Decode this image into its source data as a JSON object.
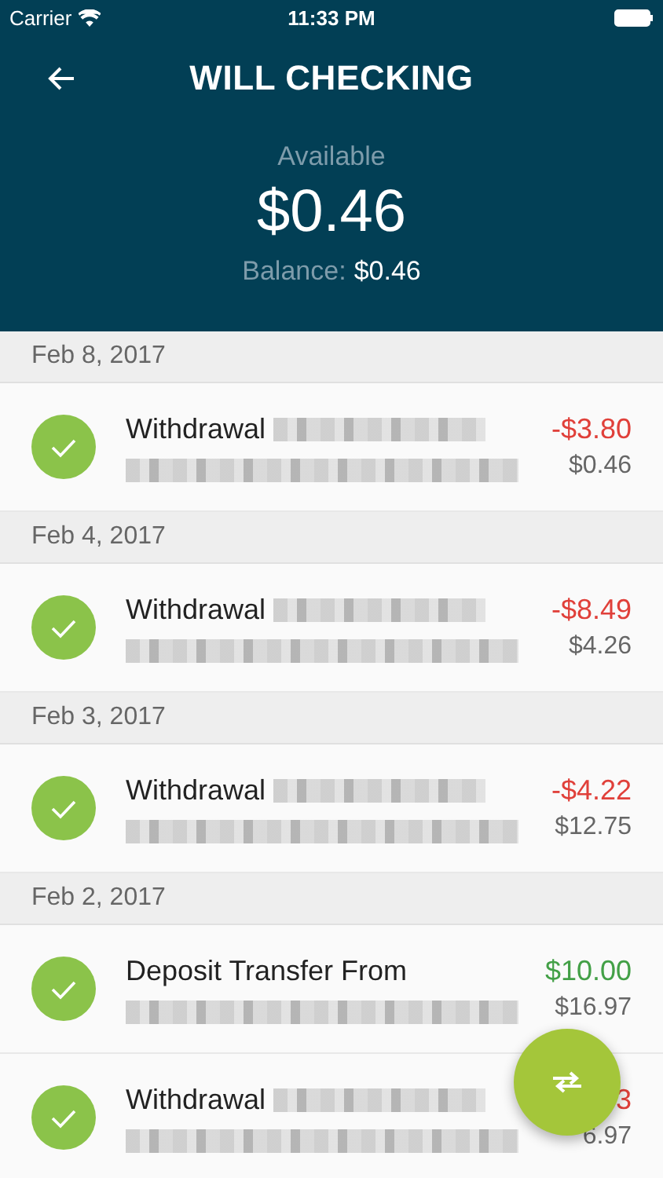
{
  "status_bar": {
    "carrier": "Carrier",
    "time": "11:33 PM"
  },
  "header": {
    "title": "WILL CHECKING",
    "available_label": "Available",
    "available_amount": "$0.46",
    "balance_label": "Balance:",
    "balance_amount": "$0.46"
  },
  "groups": [
    {
      "date": "Feb 8, 2017",
      "transactions": [
        {
          "kind": "withdrawal",
          "title": "Withdrawal",
          "amount": "-$3.80",
          "balance": "$0.46",
          "cleared": true
        }
      ]
    },
    {
      "date": "Feb 4, 2017",
      "transactions": [
        {
          "kind": "withdrawal",
          "title": "Withdrawal",
          "amount": "-$8.49",
          "balance": "$4.26",
          "cleared": true
        }
      ]
    },
    {
      "date": "Feb 3, 2017",
      "transactions": [
        {
          "kind": "withdrawal",
          "title": "Withdrawal",
          "amount": "-$4.22",
          "balance": "$12.75",
          "cleared": true
        }
      ]
    },
    {
      "date": "Feb 2, 2017",
      "transactions": [
        {
          "kind": "deposit",
          "title": "Deposit Transfer  From",
          "amount": "$10.00",
          "balance": "$16.97",
          "cleared": true
        },
        {
          "kind": "withdrawal",
          "title": "Withdrawal",
          "amount": "3",
          "balance": "6.97",
          "cleared": true
        }
      ]
    }
  ]
}
